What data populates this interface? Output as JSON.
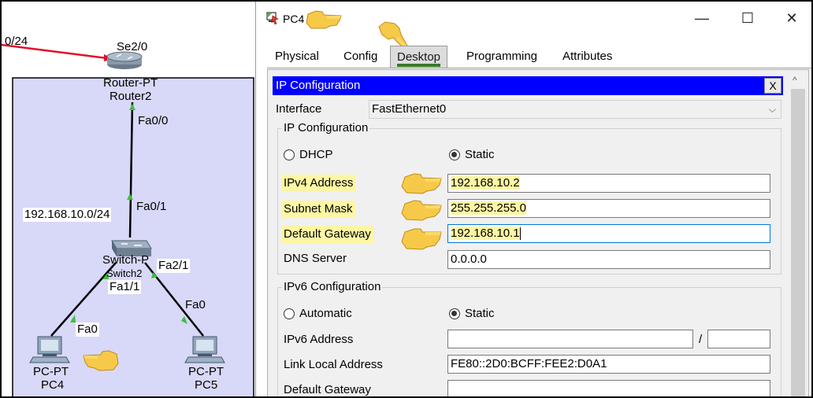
{
  "topology": {
    "link_label": "0/24",
    "router_port_top": "Se2/0",
    "router_type": "Router-PT",
    "router_name": "Router2",
    "router_port_down": "Fa0/0",
    "switch_port_up": "Fa0/1",
    "network_label": "192.168.10.0/24",
    "switch_type": "Switch-P",
    "switch_name": "Switch2",
    "switch_port_left": "Fa1/1",
    "switch_port_right": "Fa2/1",
    "pc4_port": "Fa0",
    "pc5_port": "Fa0",
    "pc4_type": "PC-PT",
    "pc4_name": "PC4",
    "pc5_type": "PC-PT",
    "pc5_name": "PC5"
  },
  "window": {
    "title": "PC4",
    "controls": {
      "minimize": "—",
      "maximize": "☐",
      "close": "✕"
    }
  },
  "tabs": [
    {
      "label": "Physical"
    },
    {
      "label": "Config"
    },
    {
      "label": "Desktop",
      "active": true
    },
    {
      "label": "Programming"
    },
    {
      "label": "Attributes"
    }
  ],
  "ip_config": {
    "bar_title": "IP Configuration",
    "close_label": "X",
    "interface_label": "Interface",
    "interface_value": "FastEthernet0",
    "ipv4_section": "IP Configuration",
    "dhcp_label": "DHCP",
    "static_label": "Static",
    "mode": "Static",
    "ipv4_label": "IPv4 Address",
    "ipv4_value": "192.168.10.2",
    "subnet_label": "Subnet Mask",
    "subnet_value": "255.255.255.0",
    "gateway_label": "Default Gateway",
    "gateway_value": "192.168.10.1",
    "dns_label": "DNS Server",
    "dns_value": "0.0.0.0",
    "ipv6_section": "IPv6 Configuration",
    "automatic_label": "Automatic",
    "static6_label": "Static",
    "ipv6_mode": "Static",
    "ipv6_label": "IPv6 Address",
    "ipv6_value": "",
    "prefix_sep": "/",
    "prefix_value": "",
    "link_local_label": "Link Local Address",
    "link_local_value": "FE80::2D0:BCFF:FEE2:D0A1",
    "gateway6_label": "Default Gateway",
    "gateway6_value": ""
  },
  "colors": {
    "highlight": "#fdf6a3",
    "config_bar": "#0000ff",
    "network_area": "#d8d8f8",
    "serial_link": "#e0102a",
    "port_marker": "#3cbf3c"
  },
  "icons": [
    "packet-tracer-pc-icon",
    "pointing-hand-icon",
    "router-icon",
    "switch-icon",
    "pc-icon",
    "chevron-down-icon",
    "radio-icon"
  ]
}
